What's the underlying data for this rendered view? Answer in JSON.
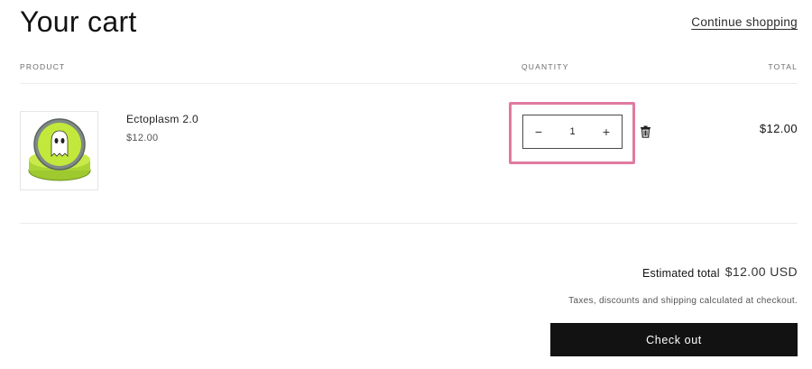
{
  "header": {
    "title": "Your cart",
    "continue_label": "Continue shopping"
  },
  "columns": {
    "product": "PRODUCT",
    "quantity": "QUANTITY",
    "total": "TOTAL"
  },
  "items": [
    {
      "name": "Ectoplasm 2.0",
      "price": "$12.00",
      "quantity": "1",
      "line_total": "$12.00",
      "image_icon": "putty-tin-image",
      "decrease_icon": "minus-icon",
      "increase_icon": "plus-icon",
      "remove_icon": "trash-icon",
      "decrease_glyph": "−",
      "increase_glyph": "+"
    }
  ],
  "summary": {
    "estimated_label": "Estimated total",
    "estimated_value": "$12.00 USD",
    "tax_note": "Taxes, discounts and shipping calculated at checkout.",
    "checkout_label": "Check out"
  },
  "colors": {
    "highlight": "#e07aa1",
    "button_bg": "#121212",
    "tin_green": "#b8e03a"
  }
}
